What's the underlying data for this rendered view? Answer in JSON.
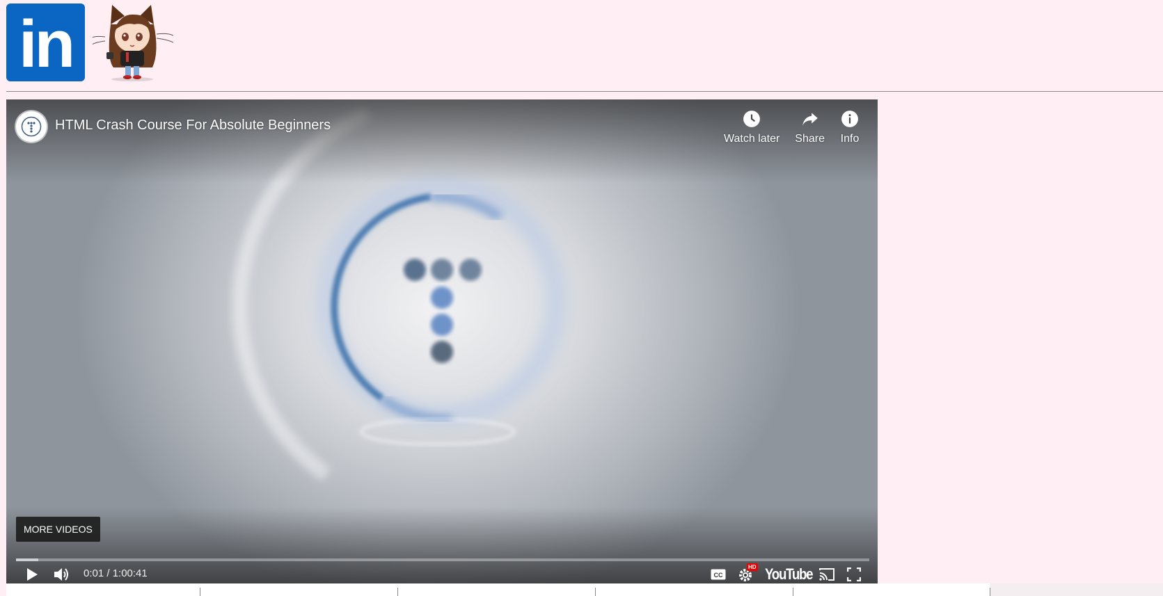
{
  "header": {
    "linkedin_logo_text": "in"
  },
  "video": {
    "title": "HTML Crash Course For Absolute Beginners",
    "actions": [
      {
        "label": "Watch later",
        "icon": "clock-icon"
      },
      {
        "label": "Share",
        "icon": "share-arrow-icon"
      },
      {
        "label": "Info",
        "icon": "info-icon"
      }
    ],
    "more_videos_label": "MORE VIDEOS",
    "time_display": "0:01 / 1:00:41",
    "progress_loaded_fraction": 0.026,
    "progress_played_fraction": 0.0,
    "youtube_logo_text": "YouTube",
    "hd_badge": "HD"
  },
  "colors": {
    "page_background": "#ffeef3",
    "linkedin_blue": "#0a66c2",
    "progress_played": "#ff0000"
  }
}
